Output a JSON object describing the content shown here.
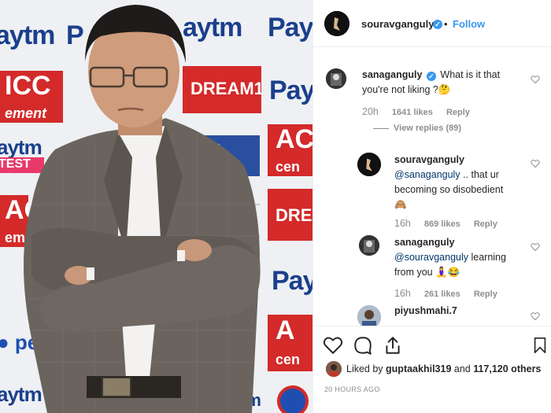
{
  "post": {
    "author": "souravganguly",
    "follow_label": "Follow",
    "header_separator": "•"
  },
  "comments": [
    {
      "user": "sanaganguly",
      "verified": true,
      "text": "What is it that you're not liking ?🤔",
      "age": "20h",
      "likes": "1641 likes",
      "reply_label": "Reply",
      "view_replies": "View replies (89)"
    },
    {
      "user": "souravganguly",
      "verified": true,
      "mention": "@sanaganguly",
      "text": " .. that ur becoming so disobedient",
      "emoji": "🙈",
      "age": "16h",
      "likes": "869 likes",
      "reply_label": "Reply"
    },
    {
      "user": "sanaganguly",
      "verified": false,
      "mention": "@souravganguly",
      "text": " learning from you",
      "emoji": "🧘‍♀️😂",
      "age": "16h",
      "likes": "261 likes",
      "reply_label": "Reply"
    },
    {
      "user": "piyushmahi.7",
      "verified": false
    }
  ],
  "footer": {
    "liked_prefix": "Liked by ",
    "liked_user": "guptaakhil319",
    "liked_and": " and ",
    "liked_count": "117,120 others",
    "time_ago": "20 HOURS AGO"
  },
  "photo_wall": {
    "sponsor_1": "Paytm",
    "sponsor_2": "ICC",
    "sponsor_3": "DREAM11",
    "sponsor_4": "Pepsi"
  },
  "colors": {
    "accent": "#3897f0",
    "meta": "#8e8e8e",
    "mention": "#00376b"
  },
  "icons": {
    "like": "heart-icon",
    "comment": "comment-icon",
    "share": "share-icon",
    "save": "bookmark-icon"
  }
}
